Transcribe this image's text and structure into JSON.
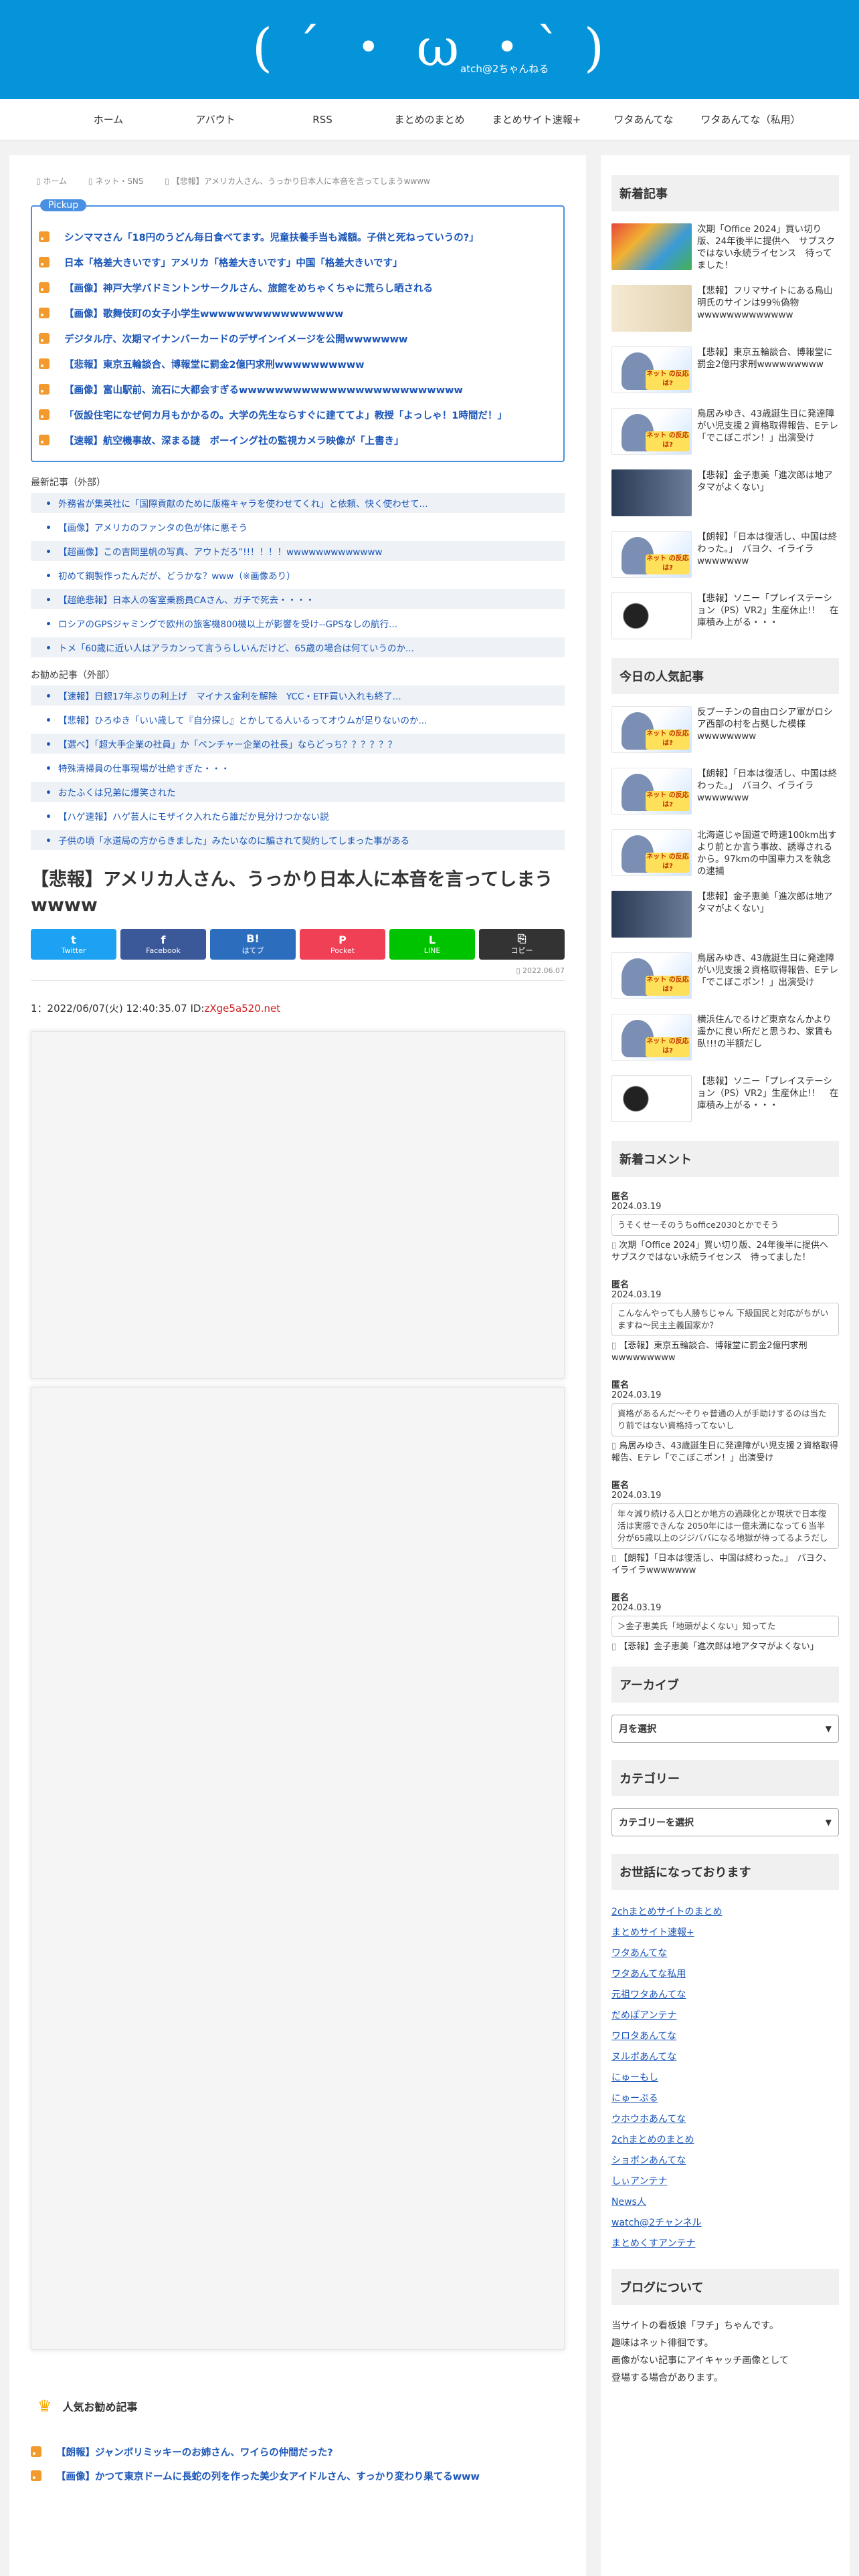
{
  "header": {
    "logo": "( ´ ・ ω ・` )",
    "logo_sub": "atch@2ちゃんねる"
  },
  "nav": [
    "ホーム",
    "アバウト",
    "RSS",
    "まとめのまとめ",
    "まとめサイト速報+",
    "ワタあんてな",
    "ワタあんてな（私用）"
  ],
  "breadcrumb": [
    "ホーム",
    "ネット・SNS",
    "【悲報】アメリカ人さん、うっかり日本人に本音を言ってしまうwwww"
  ],
  "pickup": {
    "label": "Pickup",
    "items": [
      "シンママさん「18円のうどん毎日食べてます。児童扶養手当も減額。子供と死ねっていうの?」",
      "日本「格差大きいです」アメリカ「格差大きいです」中国「格差大きいです」",
      "【画像】神戸大学バドミントンサークルさん、旅館をめちゃくちゃに荒らし晒される",
      "【画像】歌舞伎町の女子小学生wwwwwwwwwwwwwwww",
      "デジタル庁、次期マイナンバーカードのデザインイメージを公開wwwwwww",
      "【悲報】東京五輪談合、博報堂に罰金2億円求刑wwwwwwwwww",
      "【画像】富山駅前、流石に大都会すぎるwwwwwwwwwwwwwwwwwwwwwwwww",
      "「仮設住宅になぜ何カ月もかかるの。大学の先生ならすぐに建ててよ」教授「よっしゃ！1時間だ！」",
      "【速報】航空機事故、深まる謎　ボーイング社の監視カメラ映像が「上書き」"
    ]
  },
  "latest_external": {
    "title": "最新記事（外部）",
    "items": [
      "外務省が集英社に「国際貢献のために版権キャラを使わせてくれ」と依頼、快く使わせて...",
      "【画像】アメリカのファンタの色が体に悪そう",
      "【超画像】この吉岡里帆の写真、アウトだろ”!!！！！！wwwwwwwwwwwww",
      "初めて鋼製作ったんだが、どうかな？www（※画像あり）",
      "【超絶悲報】日本人の客室乗務員CAさん、ガチで死去・・・・",
      "ロシアのGPSジャミングで欧州の旅客機800機以上が影響を受け--GPSなしの航行...",
      "トメ「60歳に近い人はアラカンって言うらしいんだけど、65歳の場合は何ていうのか..."
    ]
  },
  "recommend_external": {
    "title": "お勧め記事（外部）",
    "items": [
      "【速報】日銀17年ぶりの利上げ　マイナス金利を解除　YCC・ETF買い入れも終了...",
      "【悲報】ひろゆき「いい歳して『自分探し』とかしてる人いるってオウムが足りないのか...",
      "【選べ】「超大手企業の社員」か「ベンチャー企業の社長」ならどっち？？？？？？",
      "特殊清掃員の仕事現場が壮絶すぎた・・・",
      "おたふくは兄弟に爆笑された",
      "【ハゲ速報】ハゲ芸人にモザイク入れたら誰だか見分けつかない説",
      "子供の頃「水道局の方からきました」みたいなのに騙されて契約してしまった事がある"
    ]
  },
  "article": {
    "title": "【悲報】アメリカ人さん、うっかり日本人に本音を言ってしまうwwww",
    "date": "2022.06.07",
    "res_prefix": "1：2022/06/07(火) 12:40:35.07 ID:",
    "res_id": "zXge5a520.net"
  },
  "share": [
    {
      "icon": "t",
      "label": "Twitter",
      "color": "#1da1f2"
    },
    {
      "icon": "f",
      "label": "Facebook",
      "color": "#3b5998"
    },
    {
      "icon": "B!",
      "label": "はてブ",
      "color": "#2c6ebd"
    },
    {
      "icon": "P",
      "label": "Pocket",
      "color": "#ef4056"
    },
    {
      "icon": "L",
      "label": "LINE",
      "color": "#00c300"
    },
    {
      "icon": "⎘",
      "label": "コピー",
      "color": "#333333"
    }
  ],
  "popular": {
    "title": "人気お勧め記事",
    "items": [
      "【朗報】ジャンボリミッキーのお姉さん、ワイらの仲間だった?",
      "【画像】かつて東京ドームに長蛇の列を作った美少女アイドルさん、すっかり変わり果てるwww"
    ]
  },
  "sidebar": {
    "new_title": "新着記事",
    "new_posts": [
      {
        "thumb": "office",
        "text": "次期「Office 2024」買い切り版、24年後半に提供へ　サブスクではない永続ライセンス　待ってました！"
      },
      {
        "thumb": "sketch",
        "text": "【悲報】フリマサイトにある鳥山明氏のサインは99％偽物wwwwwwwwwwwww"
      },
      {
        "thumb": "anime",
        "text": "【悲報】東京五輪談合、博報堂に罰金2億円求刑wwwwwwwww"
      },
      {
        "thumb": "anime",
        "text": "鳥居みゆき、43歳誕生日に発達障がい児支援２資格取得報告、Eテレ「でこぼこポン！」出演受け"
      },
      {
        "thumb": "news",
        "text": "【悲報】金子恵美「進次郎は地アタマがよくない」"
      },
      {
        "thumb": "anime",
        "text": "【朗報】「日本は復活し、中国は終わった。」　バヨク、イライラwwwwwww"
      },
      {
        "thumb": "vr",
        "text": "【悲報】ソニー「プレイステーション（PS）VR2」生産休止!！　在庫積み上がる・・・"
      }
    ],
    "popular_title": "今日の人気記事",
    "popular_posts": [
      {
        "thumb": "anime",
        "text": "反プーチンの自由ロシア軍がロシア西部の村を占拠した模様wwwwwwww"
      },
      {
        "thumb": "anime",
        "text": "【朗報】「日本は復活し、中国は終わった。」　バヨク、イライラwwwwwww"
      },
      {
        "thumb": "anime",
        "text": "北海道じゃ国道で時速100km出すより前とか言う事故、誘導されるから。97kmの中国車力スを執念の逮捕"
      },
      {
        "thumb": "news",
        "text": "【悲報】金子恵美「進次郎は地アタマがよくない」"
      },
      {
        "thumb": "anime",
        "text": "鳥居みゆき、43歳誕生日に発達障がい児支援２資格取得報告、Eテレ「でこぼこポン！」出演受け"
      },
      {
        "thumb": "anime",
        "text": "横浜住んでるけど東京なんかより遥かに良い所だと思うわ、家賃も臥!!!の半額だし"
      },
      {
        "thumb": "vr",
        "text": "【悲報】ソニー「プレイステーション（PS）VR2」生産休止!！　在庫積み上がる・・・"
      }
    ],
    "comments_title": "新着コメント",
    "comments": [
      {
        "name": "匿名",
        "date": "2024.03.19",
        "body": "うそくせーそのうちoffice2030とかでそう",
        "post": "次期「Office 2024」買い切り版、24年後半に提供へ　サブスクではない永続ライセンス　待ってました！"
      },
      {
        "name": "匿名",
        "date": "2024.03.19",
        "body": "こんなんやっても人勝ちじゃん 下級国民と対応がちがいますね～民主主義国家か？",
        "post": "【悲報】東京五輪談合、博報堂に罰金2億円求刑wwwwwwwww"
      },
      {
        "name": "匿名",
        "date": "2024.03.19",
        "body": "資格があるんだ～そりゃ普通の人が手助けするのは当たり前ではない資格持ってないし",
        "post": "鳥居みゆき、43歳誕生日に発達障がい児支援２資格取得報告、Eテレ「でこぼこポン！」出演受け"
      },
      {
        "name": "匿名",
        "date": "2024.03.19",
        "body": "年々減り続ける人口とか地方の過疎化とか現状で日本復活は実感できんな 2050年には一億未満になって６当半分が65歳以上のジジババになる地獄が待ってるようだし",
        "post": "【朗報】「日本は復活し、中国は終わった。」　バヨク、イライラwwwwwww"
      },
      {
        "name": "匿名",
        "date": "2024.03.19",
        "body": "＞金子恵美氏「地頭がよくない」知ってた",
        "post": "【悲報】金子恵美「進次郎は地アタマがよくない」"
      }
    ],
    "archive_title": "アーカイブ",
    "archive_select": "月を選択",
    "category_title": "カテゴリー",
    "category_select": "カテゴリーを選択",
    "links_title": "お世話になっております",
    "links": [
      "2chまとめサイトのまとめ",
      "まとめサイト速報+",
      "ワタあんてな",
      "ワタあんてな私用",
      "元祖ワタあんてな",
      "だめぽアンテナ",
      "ワロタあんてな",
      "ヌルポあんてな",
      "にゅーもし",
      "にゅーぷる",
      "ウホウホあんてな",
      "2chまとめのまとめ",
      "ショボンあんてな",
      "しぃアンテナ",
      "News人",
      "watch@2チャンネル",
      "まとめくすアンテナ"
    ],
    "about_title": "ブログについて",
    "about_lines": [
      "当サイトの看板娘「ヲチ」ちゃんです。",
      "趣味はネット徘徊です。",
      "画像がない記事にアイキャッチ画像として",
      "登場する場合があります。"
    ]
  }
}
